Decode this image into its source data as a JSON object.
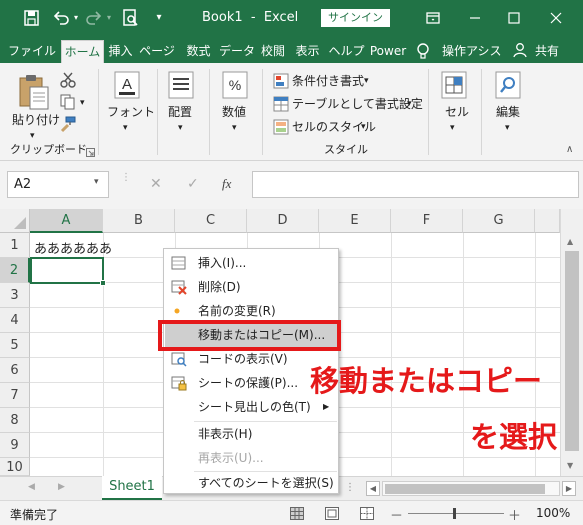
{
  "titlebar": {
    "title": "Book1  -  Excel",
    "signin": "サインイン",
    "icons": [
      "save-icon",
      "undo-icon",
      "redo-icon",
      "print-preview-icon",
      "customize-qat-icon",
      "ribbon-display-icon",
      "minimize-icon",
      "maximize-icon",
      "close-icon"
    ]
  },
  "tabs": [
    "ファイル",
    "ホーム",
    "挿入",
    "ページ",
    "数式",
    "データ",
    "校閲",
    "表示",
    "ヘルプ",
    "Power"
  ],
  "tellme": "操作アシス",
  "share": "共有",
  "ribbon": {
    "paste": "貼り付け",
    "clipboard_group": "クリップボード",
    "font": "フォント",
    "alignment": "配置",
    "number": "数値",
    "conditional_format": "条件付き書式",
    "format_as_table": "テーブルとして書式設定",
    "cell_styles": "セルのスタイル",
    "styles_group": "スタイル",
    "cells": "セル",
    "editing": "編集"
  },
  "formula_bar": {
    "name_box": "A2",
    "fx": "fx",
    "cancel": "✕",
    "enter": "✓",
    "formula": ""
  },
  "grid": {
    "columns": [
      "A",
      "B",
      "C",
      "D",
      "E",
      "F",
      "G"
    ],
    "rows": [
      "1",
      "2",
      "3",
      "4",
      "5",
      "6",
      "7",
      "8",
      "9",
      "10"
    ],
    "a1_value": "ああああああ",
    "selected_cell": "A2"
  },
  "context_menu": {
    "items": [
      {
        "label": "挿入(I)...",
        "icon": "insert-sheet-icon",
        "disabled": false
      },
      {
        "label": "削除(D)",
        "icon": "delete-sheet-icon",
        "disabled": false
      },
      {
        "label": "名前の変更(R)",
        "icon": "rename-dot-icon",
        "disabled": false
      },
      {
        "label": "移動またはコピー(M)...",
        "icon": "",
        "disabled": false
      },
      {
        "label": "コードの表示(V)",
        "icon": "view-code-icon",
        "disabled": false
      },
      {
        "label": "シートの保護(P)...",
        "icon": "protect-sheet-icon",
        "disabled": false
      },
      {
        "label": "シート見出しの色(T)",
        "icon": "",
        "disabled": false,
        "submenu": true
      },
      {
        "label": "非表示(H)",
        "icon": "",
        "disabled": false
      },
      {
        "label": "再表示(U)...",
        "icon": "",
        "disabled": true
      },
      {
        "label": "すべてのシートを選択(S)",
        "icon": "",
        "disabled": false
      }
    ]
  },
  "sheets": [
    "Sheet1"
  ],
  "status": {
    "ready": "準備完了",
    "zoom": "100%",
    "zoom_minus": "－",
    "zoom_plus": "＋"
  },
  "annotation": {
    "line1": "移動またはコピー",
    "line2": "を選択",
    "color": "#e5191a"
  },
  "colors": {
    "excel_green": "#217346",
    "highlight_red": "#e5191a"
  }
}
